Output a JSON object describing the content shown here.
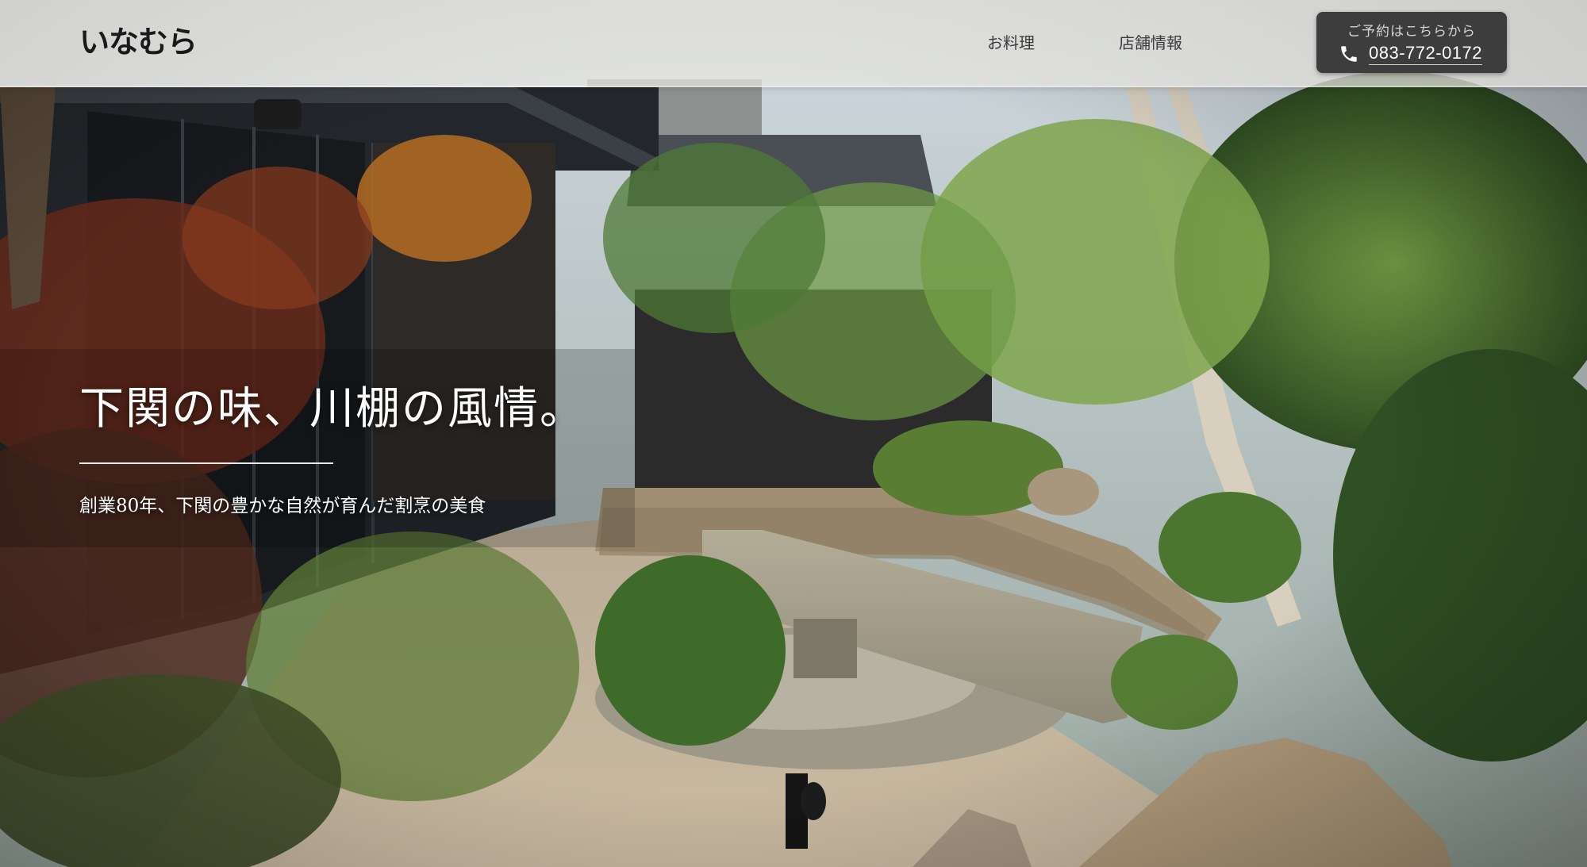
{
  "header": {
    "logo_text": "いなむら",
    "nav": [
      {
        "label": "お料理"
      },
      {
        "label": "店舗情報"
      }
    ],
    "reservation": {
      "caption": "ご予約はこちらから",
      "phone": "083-772-0172",
      "icon": "phone-icon"
    }
  },
  "hero": {
    "headline": "下関の味、川棚の風情。",
    "subline": "創業80年、下関の豊かな自然が育んだ割烹の美食",
    "image_description_icon": "garden-photo"
  },
  "colors": {
    "header_bg": "#e8e6e0",
    "reserve_bg": "#3d3d3d",
    "headline_text": "#ffffff"
  }
}
